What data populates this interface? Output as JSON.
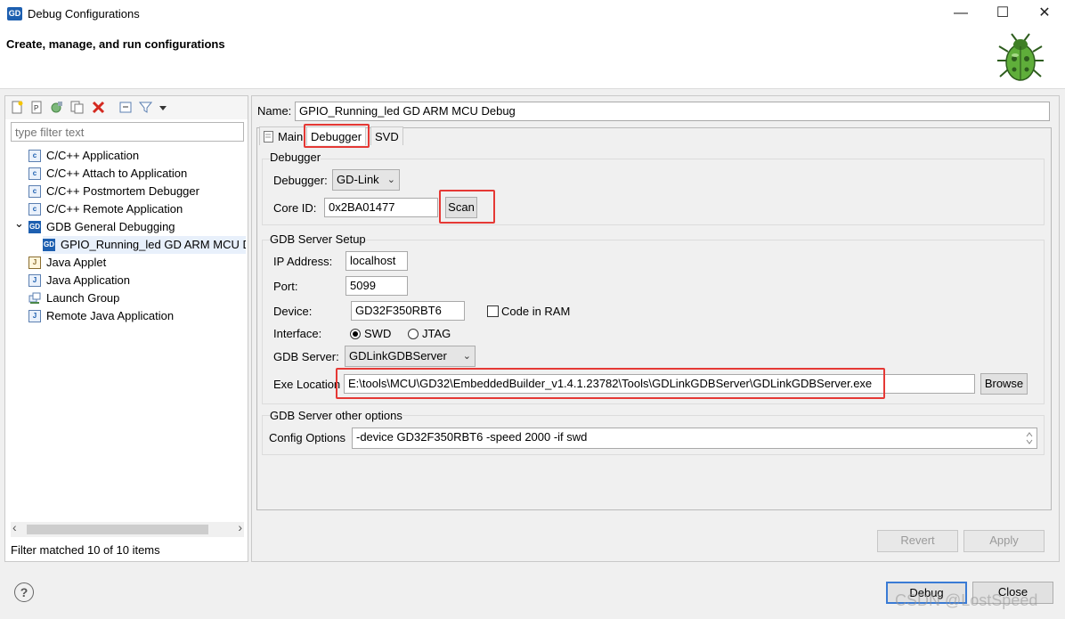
{
  "window": {
    "app_icon": "GD",
    "title": "Debug Configurations",
    "header_title": "Create, manage, and run configurations",
    "minimize_glyph": "—",
    "maximize_glyph": "☐",
    "close_glyph": "✕"
  },
  "left": {
    "filter_placeholder": "type filter text",
    "tree": [
      {
        "label": "C/C++ Application",
        "icon": "c-app-icon"
      },
      {
        "label": "C/C++ Attach to Application",
        "icon": "c-attach-icon"
      },
      {
        "label": "C/C++ Postmortem Debugger",
        "icon": "c-postmortem-icon"
      },
      {
        "label": "C/C++ Remote Application",
        "icon": "c-remote-icon"
      },
      {
        "label": "GDB General Debugging",
        "icon": "gd-icon"
      },
      {
        "label": "GPIO_Running_led GD ARM MCU D",
        "icon": "gd-icon"
      },
      {
        "label": "Java Applet",
        "icon": "java-applet-icon"
      },
      {
        "label": "Java Application",
        "icon": "java-app-icon"
      },
      {
        "label": "Launch Group",
        "icon": "launch-group-icon"
      },
      {
        "label": "Remote Java Application",
        "icon": "remote-java-icon"
      }
    ],
    "expand_glyph": "⌄",
    "icon_c": "c",
    "icon_gd": "GD",
    "icon_j": "J",
    "filter_status": "Filter matched 10 of 10 items",
    "scroll_left": "‹",
    "scroll_right": "›"
  },
  "right": {
    "name_label": "Name:",
    "name_value": "GPIO_Running_led GD ARM MCU Debug",
    "tabs": [
      "Main",
      "Debugger",
      "SVD"
    ],
    "debugger_group": "Debugger",
    "debugger_label": "Debugger:",
    "debugger_value": "GD-Link",
    "core_id_label": "Core ID:",
    "core_id_value": "0x2BA01477",
    "scan_label": "Scan",
    "gdb_group": "GDB Server Setup",
    "ip_label": "IP Address:",
    "ip_value": "localhost",
    "port_label": "Port:",
    "port_value": "5099",
    "device_label": "Device:",
    "device_value": "GD32F350RBT6",
    "code_in_ram_label": "Code in RAM",
    "interface_label": "Interface:",
    "swd_label": "SWD",
    "jtag_label": "JTAG",
    "gdb_server_label": "GDB Server:",
    "gdb_server_value": "GDLinkGDBServer",
    "exe_label": "Exe Location",
    "exe_value": "E:\\tools\\MCU\\GD32\\EmbeddedBuilder_v1.4.1.23782\\Tools\\GDLinkGDBServer\\GDLinkGDBServer.exe",
    "browse_label": "Browse",
    "other_group": "GDB Server other options",
    "config_label": "Config Options",
    "config_value": "-device GD32F350RBT6 -speed 2000 -if swd",
    "revert_label": "Revert",
    "apply_label": "Apply"
  },
  "footer": {
    "help_glyph": "?",
    "debug_label": "Debug",
    "close_label": "Close",
    "watermark": "CSDN @LostSpeed"
  },
  "colors": {
    "highlight": "#e53935",
    "accent": "#1d5fb0"
  }
}
